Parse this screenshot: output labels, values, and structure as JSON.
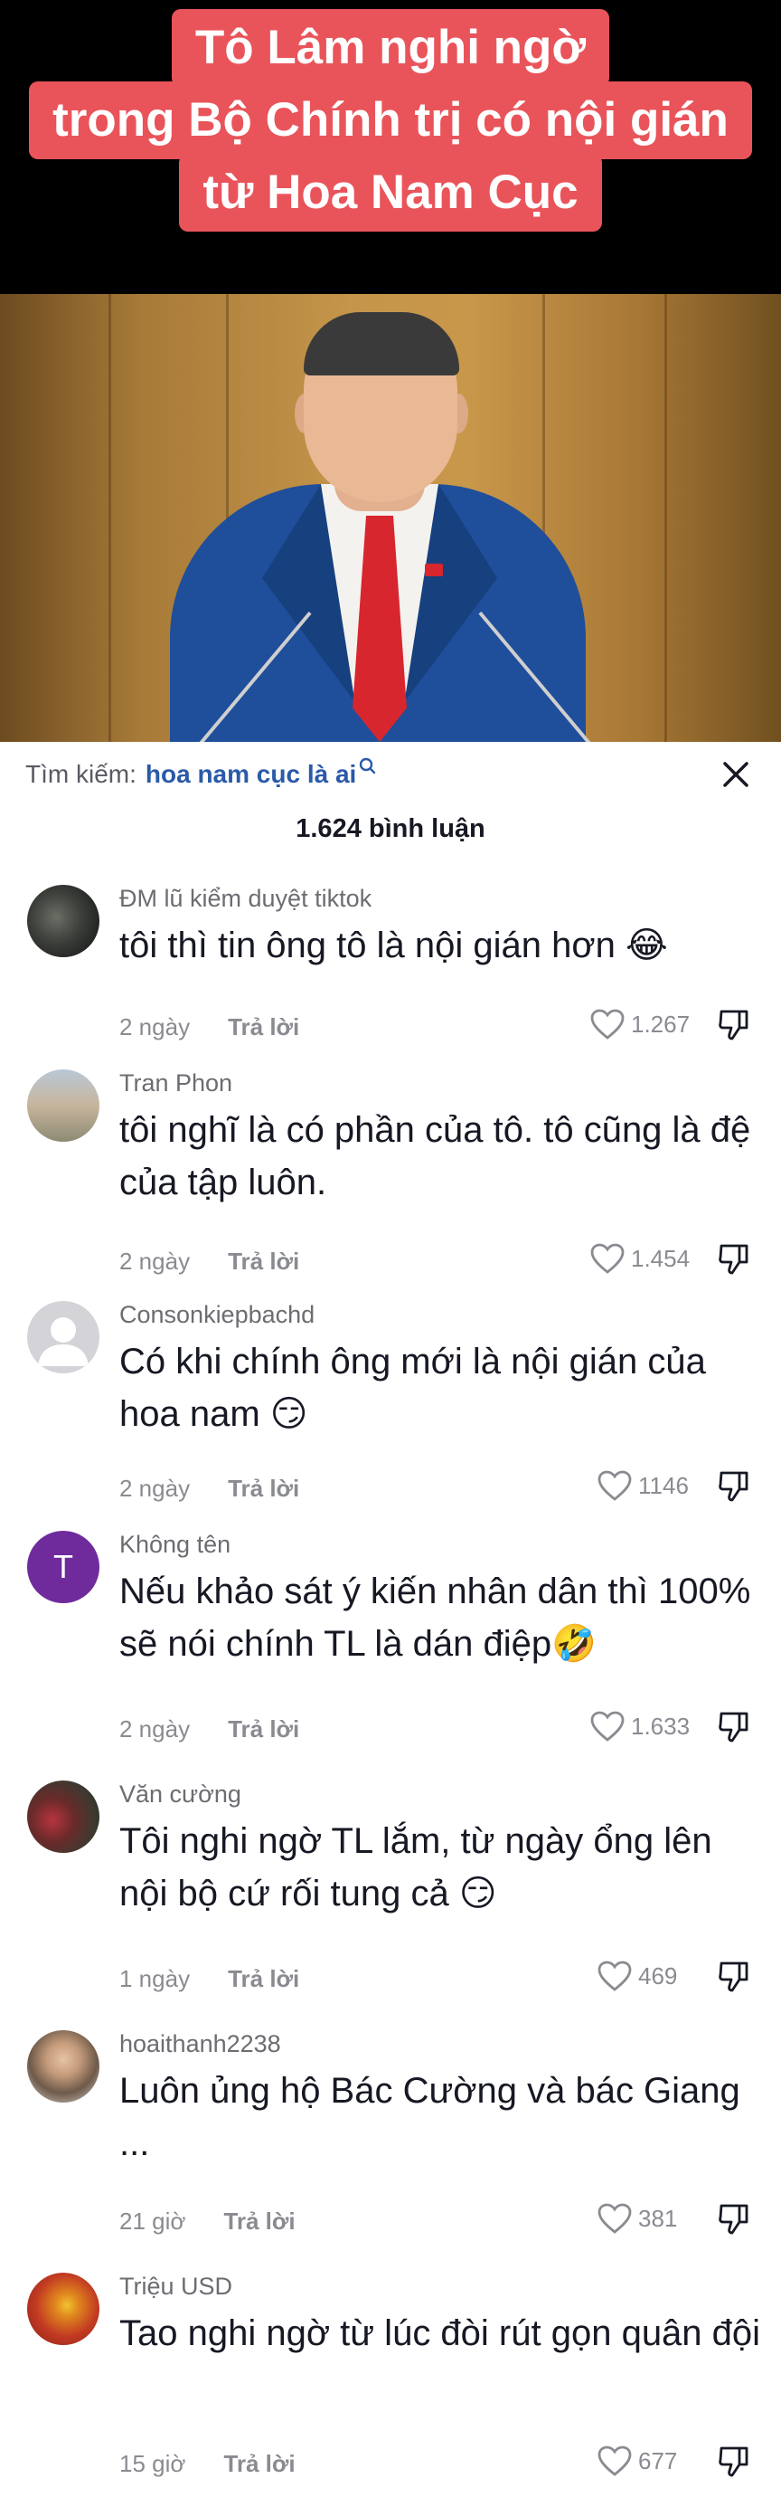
{
  "video": {
    "caption_lines": [
      "Tô Lâm nghi ngờ",
      "trong Bộ Chính trị có nội gián",
      "từ Hoa Nam Cục"
    ]
  },
  "search": {
    "label": "Tìm kiếm:",
    "query": "hoa nam cục là ai"
  },
  "comment_count": "1.624 bình luận",
  "reply_label": "Trả lời",
  "comments": [
    {
      "username": "ĐM lũ kiểm duyệt tiktok",
      "text": "tôi thì tin ông tô là nội gián hơn 😂",
      "time": "2 ngày",
      "likes": "1.267"
    },
    {
      "username": "Tran Phon",
      "text": "tôi nghĩ là có phần của tô. tô cũng là đệ của tập luôn.",
      "time": "2 ngày",
      "likes": "1.454"
    },
    {
      "username": "Consonkiepbachd",
      "text": "Có khi chính ông mới là nội gián của hoa nam 😏",
      "time": "2 ngày",
      "likes": "1146"
    },
    {
      "username": "Không tên",
      "avatar_letter": "T",
      "text": "Nếu khảo sát ý kiến nhân dân thì 100% sẽ nói chính TL là dán điệp🤣",
      "time": "2 ngày",
      "likes": "1.633"
    },
    {
      "username": "Văn cường",
      "text": "Tôi nghi ngờ TL lắm, từ ngày ổng lên nội bộ cứ rối tung cả 😏",
      "time": "1 ngày",
      "likes": "469"
    },
    {
      "username": "hoaithanh2238",
      "text": "Luôn ủng hộ Bác Cường và bác Giang ...",
      "time": "21 giờ",
      "likes": "381"
    },
    {
      "username": "Triệu USD",
      "text": "Tao nghi ngờ từ lúc đòi rút gọn  quân đội",
      "time": "15 giờ",
      "likes": "677"
    }
  ],
  "colors": {
    "caption_bg": "#e9545a",
    "search_query": "#2a5aa8",
    "meta_text": "#8a8b91",
    "avatar_letter_bg": "#6f2a9c"
  },
  "icons": {
    "search": "search-icon",
    "close": "close-icon",
    "like": "heart-icon",
    "dislike": "dislike-icon"
  }
}
